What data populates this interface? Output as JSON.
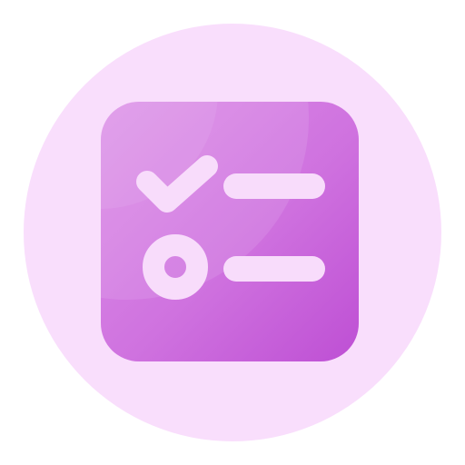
{
  "icon": {
    "name": "checklist-icon",
    "colors": {
      "background": "#ffffff",
      "circle": "#f9defc",
      "tile_light": "#dc8ee8",
      "tile_mid": "#cf72df",
      "tile_dark": "#be4fd4",
      "glyph": "#f8dcfb"
    },
    "items": [
      {
        "marker": "check-mark-icon",
        "state": "checked"
      },
      {
        "marker": "open-circle-icon",
        "state": "unchecked"
      }
    ]
  }
}
